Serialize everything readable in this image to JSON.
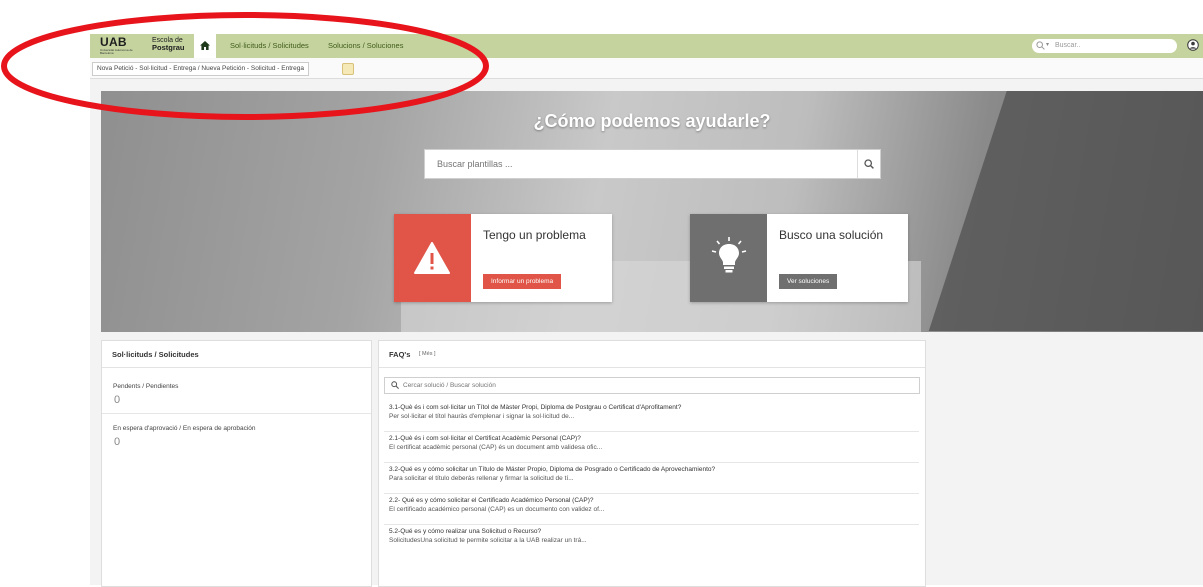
{
  "colors": {
    "topbar": "#c5d49f",
    "nav_link": "#3f5a18",
    "problem_accent": "#e05547",
    "solution_accent": "#6f6f6f",
    "annotation": "#e8141b"
  },
  "header": {
    "logo": "UAB",
    "logo_sub": "Universitat Autònoma de Barcelona",
    "school_line1": "Escola de",
    "school_line2": "Postgrau",
    "home_icon": "home-icon",
    "nav": [
      {
        "label": "Sol·licituds / Solicitudes"
      },
      {
        "label": "Solucions / Soluciones"
      }
    ],
    "search": {
      "placeholder": "Buscar..",
      "dropdown": "▾"
    },
    "user_icon": "user-icon"
  },
  "breadcrumb": {
    "text": "Nova Petició - Sol·licitud - Entrega / Nueva Petición - Solicitud - Entrega"
  },
  "hero": {
    "title": "¿Cómo podemos ayudarle?",
    "search_placeholder": "Buscar plantillas ...",
    "cards": [
      {
        "title": "Tengo un problema",
        "button": "Informar un problema",
        "icon": "warning-icon"
      },
      {
        "title": "Busco una solución",
        "button": "Ver soluciones",
        "icon": "lightbulb-icon"
      }
    ]
  },
  "requests": {
    "title": "Sol·licituds / Solicitudes",
    "items": [
      {
        "label": "Pendents / Pendientes",
        "count": "0"
      },
      {
        "label": "En espera d'aprovació / En espera de aprobación",
        "count": "0"
      }
    ]
  },
  "faq": {
    "title": "FAQ's",
    "more": "[ Més ]",
    "search_placeholder": "Cercar solució / Buscar solución",
    "items": [
      {
        "q": "3.1-Què és i com sol·licitar un Títol de Màster Propi, Diploma de Postgrau o Certificat d'Aprofitament?",
        "a": "Per sol·licitar el títol hauràs d'emplenar i signar la  sol·licitud de..."
      },
      {
        "q": "2.1-Què és i com sol·licitar el Certificat Acadèmic Personal (CAP)?",
        "a": "El certificat acadèmic personal (CAP) és un document amb validesa ofic..."
      },
      {
        "q": "3.2-Qué es y cómo solicitar un Título de Máster Propio, Diploma de Posgrado o Certificado de Aprovechamiento?",
        "a": "Para solicitar el título deberás rellenar y firmar la solicitud de tí..."
      },
      {
        "q": "2.2- Qué es y cómo solicitar el Certificado Académico Personal (CAP)?",
        "a": "El certificado académico personal (CAP) es un documento con validez of..."
      },
      {
        "q": "5.2-Qué es y cómo realizar una Solicitud o Recurso?",
        "a": "SolicitudesUna solicitud te permite solicitar a la UAB realizar un trá..."
      }
    ]
  }
}
